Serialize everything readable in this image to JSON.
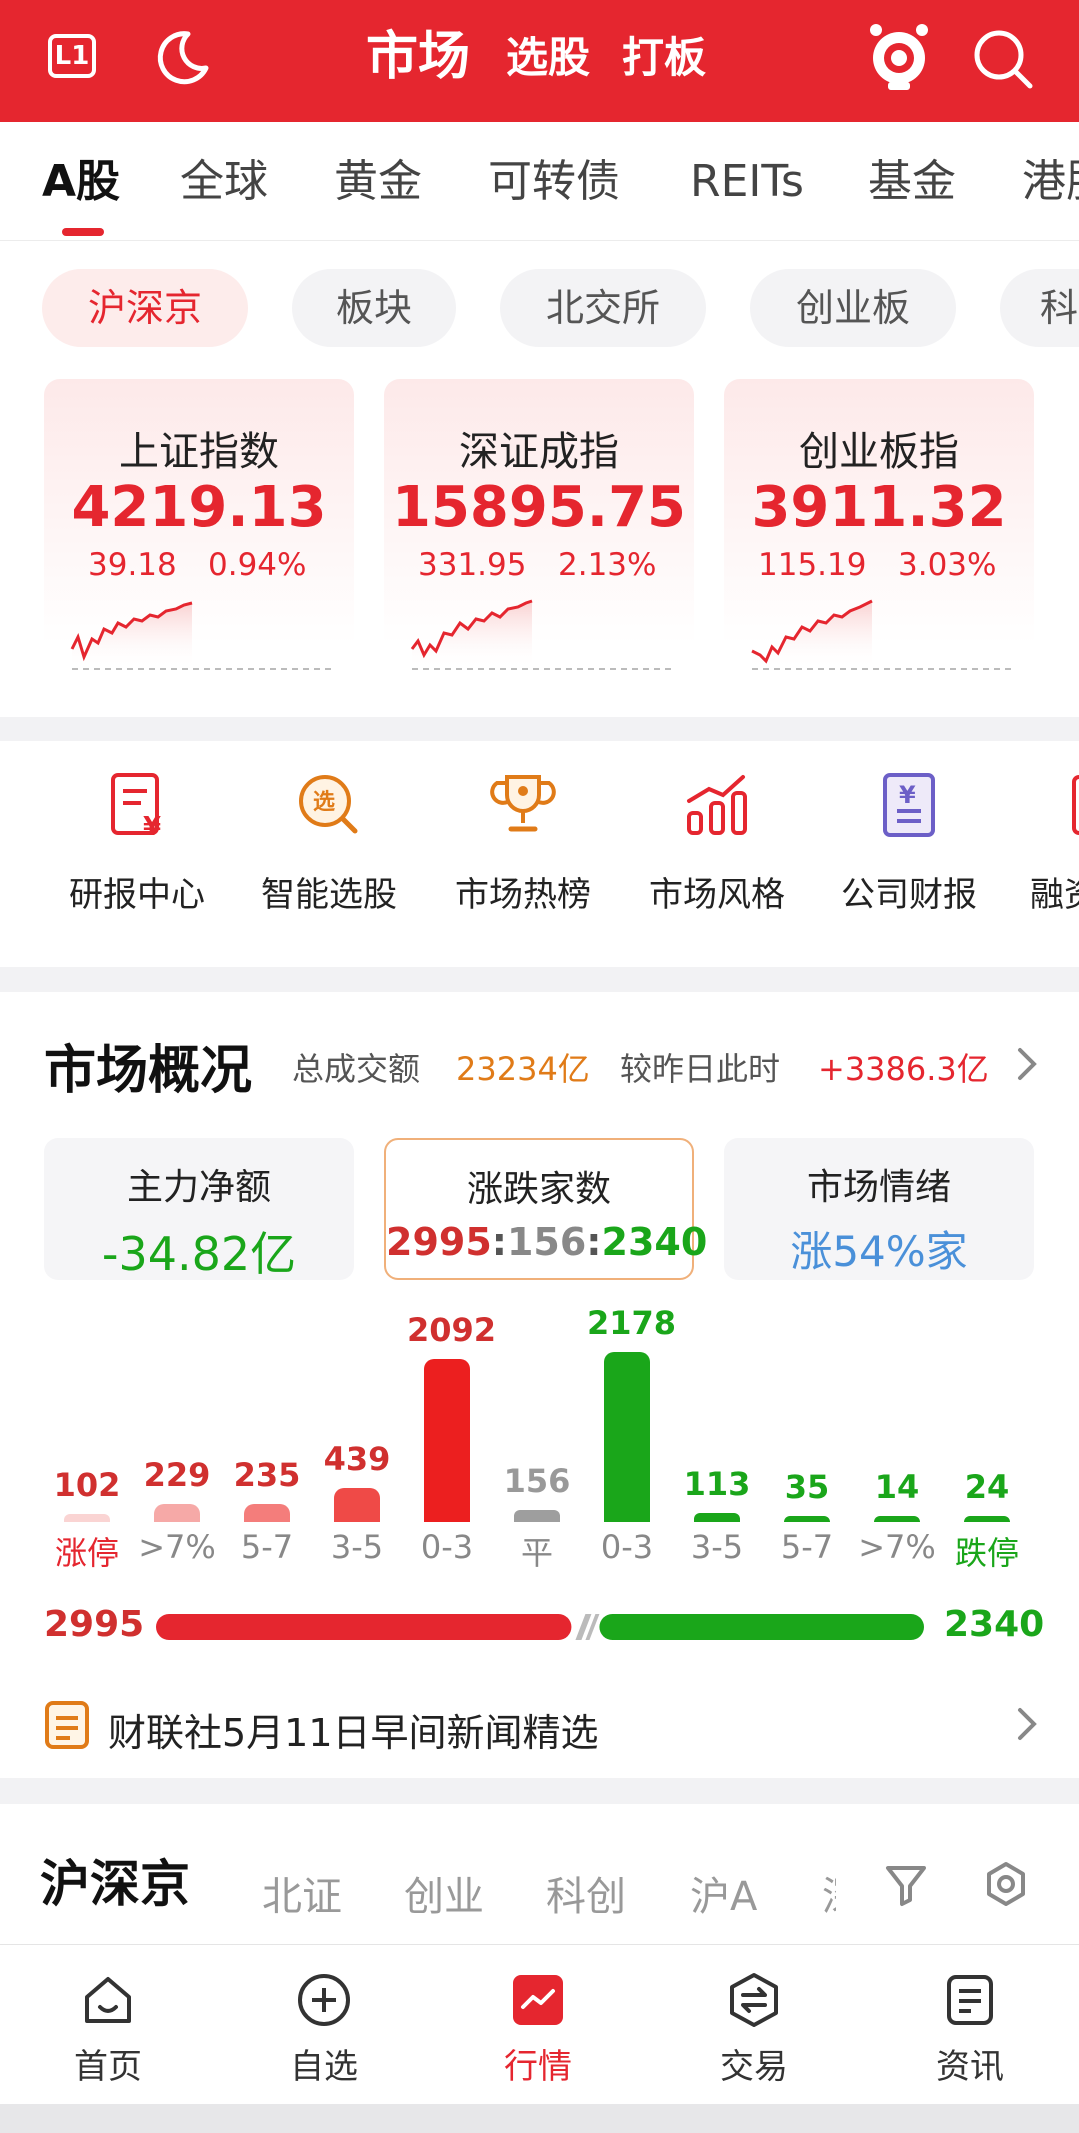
{
  "header": {
    "level_badge": "L1",
    "title": "市场",
    "links": [
      "选股",
      "打板"
    ]
  },
  "tabs": [
    "A股",
    "全球",
    "黄金",
    "可转债",
    "REITs",
    "基金",
    "港股"
  ],
  "chips": [
    "沪深京",
    "板块",
    "北交所",
    "创业板",
    "科"
  ],
  "indices": [
    {
      "name": "上证指数",
      "value": "4219.13",
      "change": "39.18",
      "pct": "0.94%"
    },
    {
      "name": "深证成指",
      "value": "15895.75",
      "change": "331.95",
      "pct": "2.13%"
    },
    {
      "name": "创业板指",
      "value": "3911.32",
      "change": "115.19",
      "pct": "3.03%"
    }
  ],
  "quick_links": [
    {
      "label": "研报中心",
      "icon": "report-icon"
    },
    {
      "label": "智能选股",
      "icon": "smart-pick-icon"
    },
    {
      "label": "市场热榜",
      "icon": "trophy-icon"
    },
    {
      "label": "市场风格",
      "icon": "bar-style-icon"
    },
    {
      "label": "公司财报",
      "icon": "finance-report-icon"
    },
    {
      "label": "融资",
      "icon": "margin-icon"
    }
  ],
  "overview": {
    "title": "市场概况",
    "turnover_label": "总成交额",
    "turnover_value": "23234亿",
    "compare_label": "较昨日此时",
    "compare_value": "+3386.3亿",
    "boxes": [
      {
        "title": "主力净额",
        "value": "-34.82亿"
      },
      {
        "title": "涨跌家数",
        "up": "2995",
        "flat": "156",
        "down": "2340",
        "sep": ":"
      },
      {
        "title": "市场情绪",
        "value": "涨54%家"
      }
    ],
    "ratio": {
      "up": "2995",
      "down": "2340"
    },
    "news": "财联社5月11日早间新闻精选"
  },
  "chart_data": {
    "type": "bar",
    "categories": [
      "涨停",
      ">7%",
      "5-7",
      "3-5",
      "0-3",
      "平",
      "0-3",
      ">3-5",
      "5-7",
      ">7%",
      "跌停"
    ],
    "labels": [
      "涨停",
      ">7%",
      "5-7",
      "3-5",
      "0-3",
      "平",
      "0-3",
      "3-5",
      "5-7",
      ">7%",
      "跌停"
    ],
    "values": [
      102,
      229,
      235,
      439,
      2092,
      156,
      2178,
      113,
      35,
      14,
      24
    ],
    "value_labels": [
      "102",
      "229",
      "235",
      "439",
      "2092",
      "156",
      "2178",
      "113",
      "35",
      "14",
      "24"
    ],
    "colors": [
      "#fad4d3",
      "#f6a9a7",
      "#f47d7b",
      "#ef4a47",
      "#ec1f1f",
      "#9e9e9e",
      "#1aa61a",
      "#1aa61a",
      "#1aa61a",
      "#1aa61a",
      "#1aa61a"
    ],
    "label_colors": [
      "#e5262f",
      "#888888",
      "#888888",
      "#888888",
      "#888888",
      "#888888",
      "#888888",
      "#888888",
      "#888888",
      "#888888",
      "#1aa61a"
    ],
    "num_colors": [
      "#d0302f",
      "#d0302f",
      "#d0302f",
      "#d0302f",
      "#d0302f",
      "#999999",
      "#1aa61a",
      "#1aa61a",
      "#1aa61a",
      "#1aa61a",
      "#1aa61a"
    ]
  },
  "list": {
    "title": "沪深京",
    "tabs": [
      "北证",
      "创业",
      "科创",
      "沪A",
      "深"
    ]
  },
  "bottom_nav": [
    "首页",
    "自选",
    "行情",
    "交易",
    "资讯"
  ],
  "colors": {
    "brand": "#e5262f",
    "up": "#e5262f",
    "down": "#1aa61a",
    "accent": "#e07b18",
    "mood": "#4a90d9"
  }
}
